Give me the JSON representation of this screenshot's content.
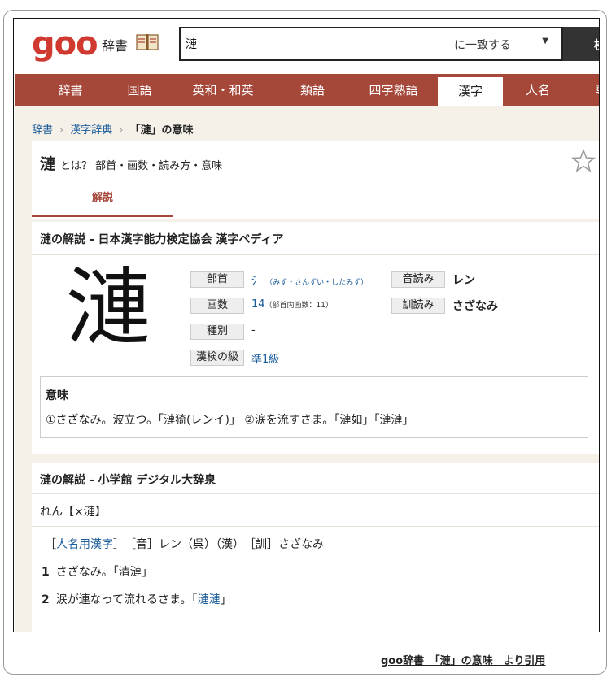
{
  "header": {
    "logo": "goo",
    "site_name": "辞書",
    "search_value": "漣",
    "match_option": "に一致する",
    "search_button": "検"
  },
  "nav": {
    "items": [
      "辞書",
      "国語",
      "英和・和英",
      "類語",
      "四字熟語",
      "漢字",
      "人名",
      "専"
    ],
    "active": "漢字"
  },
  "breadcrumb": {
    "items": [
      "辞書",
      "漢字辞典"
    ],
    "current": "「漣」の意味"
  },
  "title": {
    "kanji": "漣",
    "suffix": "とは？ 部首・画数・読み方・意味",
    "tab": "解説"
  },
  "section1": {
    "heading": "漣の解説 - 日本漢字能力検定協会 漢字ペディア",
    "big_kanji": "漣",
    "fields": {
      "bushu_label": "部首",
      "bushu_value": "氵",
      "bushu_note": "（みず・さんずい・したみず）",
      "kakusu_label": "画数",
      "kakusu_value": "14",
      "kakusu_note": "（部首内画数：11）",
      "shubetsu_label": "種別",
      "shubetsu_value": "-",
      "kanken_label": "漢検の級",
      "kanken_value": "準1級",
      "on_label": "音読み",
      "on_value": "レン",
      "kun_label": "訓読み",
      "kun_value": "さざなみ"
    },
    "meaning_title": "意味",
    "meaning_text": "①さざなみ。波立つ。「漣猗(レンイ)」 ②涙を流すさま。「漣如」「漣漣」"
  },
  "section2": {
    "heading": "漣の解説 - 小学館 デジタル大辞泉",
    "reading": "れん【×漣】",
    "info_open": "［",
    "info_link": "人名用漢字",
    "info_rest": "］　［音］レン（呉）（漢）　［訓］さざなみ",
    "def1_num": "1",
    "def1_text": "さざなみ。「清漣」",
    "def2_num": "2",
    "def2_text": "涙が連なって流れるさま。「",
    "def2_link": "漣漣",
    "def2_end": "」"
  },
  "footer": {
    "citation": "goo辞書　「漣」の意味　より引用"
  },
  "colors": {
    "nav_bg": "#a5483a",
    "logo": "#d0392f",
    "link": "#1a5b9a",
    "content_bg": "#f5f1e9"
  }
}
